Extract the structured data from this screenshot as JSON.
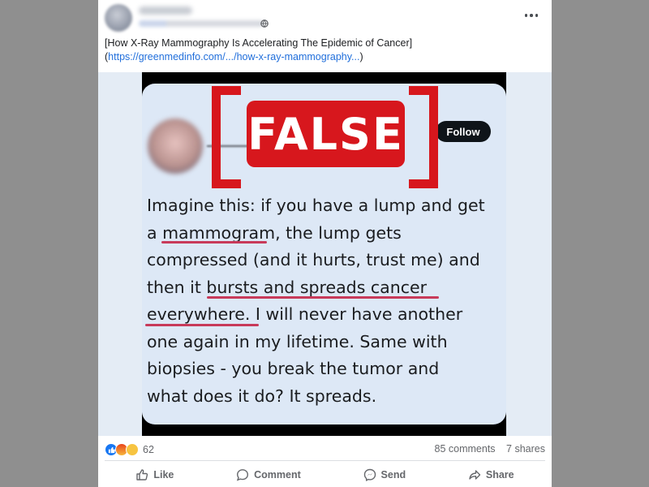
{
  "post": {
    "title": "[How X-Ray Mammography Is Accelerating The Epidemic of Cancer]",
    "link_open": "(",
    "link_text": "https://greenmedinfo.com/.../how-x-ray-mammography...",
    "link_close": ")",
    "more_icon": "more-horizontal-icon",
    "privacy_icon": "globe-icon"
  },
  "image": {
    "stamp_text": "FALSE",
    "follow_label": "Follow",
    "tweet_lines": [
      "Imagine this: if you have a lump and get",
      "a mammogram, the lump gets",
      "compressed (and it hurts, trust me) and",
      "then it bursts and spreads cancer",
      "everywhere. I will never have another",
      "one again in my lifetime. Same with",
      "biopsies - you break the tumor and",
      "what does it do? It spreads."
    ],
    "stamp_color": "#d7171d",
    "underline_color": "#c83a5a"
  },
  "footer": {
    "reaction_count": "62",
    "comments": "85 comments",
    "shares": "7 shares",
    "actions": [
      {
        "label": "Like",
        "icon": "thumbs-up-icon"
      },
      {
        "label": "Comment",
        "icon": "comment-icon"
      },
      {
        "label": "Send",
        "icon": "messenger-icon"
      },
      {
        "label": "Share",
        "icon": "share-icon"
      }
    ]
  },
  "colors": {
    "link": "#216fdb",
    "like_blue": "#1877f2",
    "muted_text": "#65676b"
  }
}
